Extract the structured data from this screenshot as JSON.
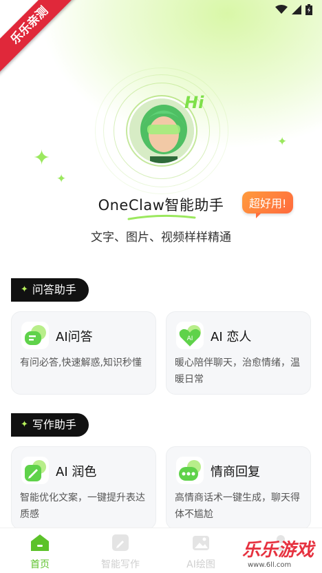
{
  "watermark_ribbon": {
    "text": "乐乐亲测"
  },
  "hero": {
    "greeting": "Hi",
    "app_title": "OneClaw智能助手",
    "badge": "超好用!",
    "subtitle": "文字、图片、视频样样精通"
  },
  "sections": [
    {
      "title": "问答助手",
      "cards": [
        {
          "title": "AI问答",
          "desc": "有问必答,快速解惑,知识秒懂",
          "icon": "chat-bubble-icon"
        },
        {
          "title": "AI 恋人",
          "desc": "暖心陪伴聊天，治愈情绪，温暖日常",
          "icon": "ai-heart-icon"
        }
      ]
    },
    {
      "title": "写作助手",
      "cards": [
        {
          "title": "AI 润色",
          "desc": "智能优化文案，一键提升表达质感",
          "icon": "pencil-icon"
        },
        {
          "title": "情商回复",
          "desc": "高情商话术一键生成，聊天得体不尴尬",
          "icon": "dots-bubble-icon"
        }
      ]
    }
  ],
  "tabbar": {
    "tabs": [
      {
        "label": "首页",
        "active": true
      },
      {
        "label": "智能写作",
        "active": false
      },
      {
        "label": "AI绘图",
        "active": false
      }
    ]
  },
  "corner_watermark": {
    "text": "乐乐游戏",
    "url": "www.6ll.com"
  },
  "colors": {
    "accent": "#7ed33b",
    "active_tab": "#5cc22a",
    "badge": "#ff7a3d"
  }
}
